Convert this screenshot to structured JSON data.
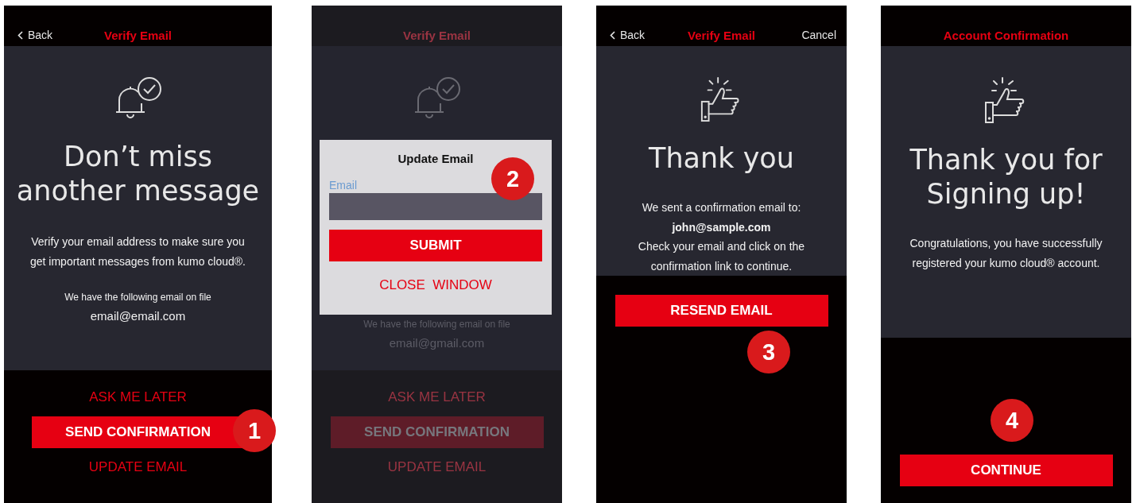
{
  "screens": [
    {
      "kind": "verify",
      "dimmed": false,
      "header": {
        "back": "Back",
        "title": "Verify Email"
      },
      "heading": "Don’t miss\nanother message",
      "body": "Verify your email address to make sure you get important messages from kumo cloud®.",
      "note": "We have the following email on file",
      "email": "email@email.com",
      "actions": [
        {
          "kind": "link",
          "label": "ASK ME LATER"
        },
        {
          "kind": "primary",
          "label": "SEND CONFIRMATION"
        },
        {
          "kind": "link",
          "label": "UPDATE EMAIL"
        }
      ],
      "step": "1"
    },
    {
      "kind": "verify",
      "dimmed": true,
      "header": {
        "title": "Verify Email"
      },
      "note": "We have the following email on file",
      "email": "email@gmail.com",
      "actions": [
        {
          "kind": "link",
          "label": "ASK ME LATER"
        },
        {
          "kind": "primary",
          "label": "SEND CONFIRMATION"
        },
        {
          "kind": "link",
          "label": "UPDATE EMAIL"
        }
      ],
      "modal": {
        "title": "Update Email",
        "field_label": "Email",
        "submit": "SUBMIT",
        "close": "CLOSE  WINDOW"
      },
      "step": "2"
    },
    {
      "kind": "thanks",
      "dimmed": false,
      "header": {
        "back": "Back",
        "title": "Verify Email",
        "cancel": "Cancel"
      },
      "heading": "Thank you",
      "body": "We sent a confirmation email to:\n**john@sample.com**\nCheck your email and click on the\nconfirmation link to continue.",
      "actions": [
        {
          "kind": "primary",
          "label": "RESEND EMAIL"
        }
      ],
      "step": "3"
    },
    {
      "kind": "done",
      "dimmed": false,
      "header": {
        "title": "Account Confirmation"
      },
      "heading": "Thank you for\nSigning up!",
      "body": "Congratulations, you have successfully registered your kumo cloud® account.",
      "actions": [
        {
          "kind": "primary",
          "label": "CONTINUE"
        }
      ],
      "step": "4"
    }
  ]
}
